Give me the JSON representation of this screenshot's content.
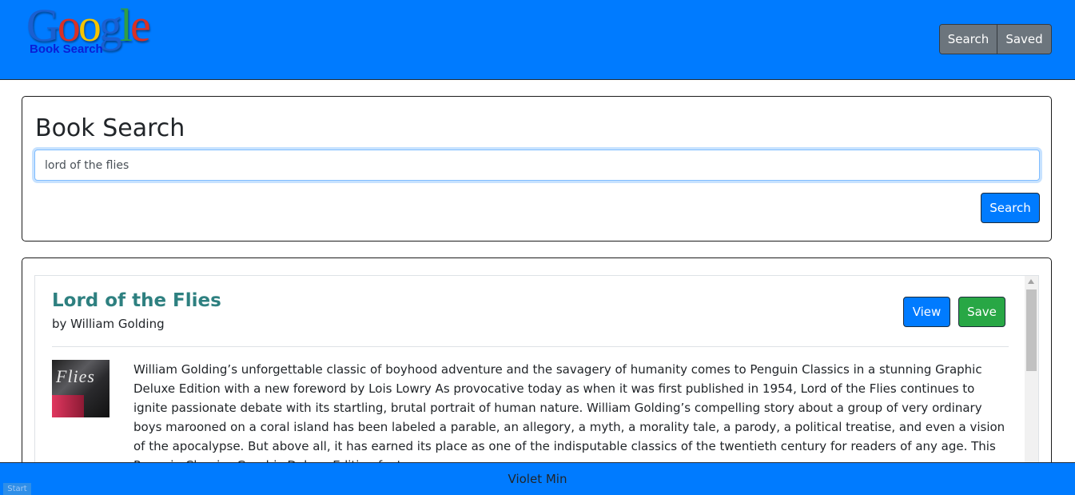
{
  "logo": {
    "word": [
      "G",
      "o",
      "o",
      "g",
      "l",
      "e"
    ],
    "subtitle": "Book Search"
  },
  "nav": {
    "search_label": "Search",
    "saved_label": "Saved"
  },
  "search": {
    "heading": "Book Search",
    "query_value": "lord of the flies",
    "button_label": "Search"
  },
  "results": [
    {
      "title": "Lord of the Flies",
      "author": "by William Golding",
      "view_label": "View",
      "save_label": "Save",
      "cover_text": "Flies",
      "description": "William Golding’s unforgettable classic of boyhood adventure and the savagery of humanity comes to Penguin Classics in a stunning Graphic Deluxe Edition with a new foreword by Lois Lowry As provocative today as when it was first published in 1954, Lord of the Flies continues to ignite passionate debate with its startling, brutal portrait of human nature. William Golding’s compelling story about a group of very ordinary boys marooned on a coral island has been labeled a parable, an allegory, a myth, a morality tale, a parody, a political treatise, and even a vision of the apocalypse. But above all, it has earned its place as one of the indisputable classics of the twentieth century for readers of any age. This Penguin Classics Graphic Deluxe Edition features an"
    }
  ],
  "footer": {
    "text": "Violet Min"
  },
  "start_chip": "Start",
  "colors": {
    "primary": "#007bff",
    "success": "#28a745",
    "secondary": "#6c757d",
    "title_teal": "#2e8080"
  }
}
